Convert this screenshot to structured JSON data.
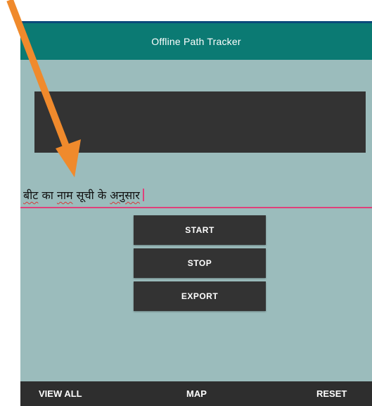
{
  "app_bar": {
    "title": "Offline Path Tracker"
  },
  "input": {
    "parts": [
      {
        "text": "बीट",
        "underline": true
      },
      {
        "text": " का ",
        "underline": false
      },
      {
        "text": "नाम",
        "underline": true
      },
      {
        "text": " सूची के ",
        "underline": false
      },
      {
        "text": "अनुसार",
        "underline": true
      }
    ]
  },
  "buttons": {
    "start": "START",
    "stop": "STOP",
    "export": "EXPORT"
  },
  "bottom_bar": {
    "view_all": "VIEW ALL",
    "map": "MAP",
    "reset": "RESET"
  },
  "colors": {
    "app_bar": "#0b7a73",
    "background": "#9bbcbc",
    "button": "#333333",
    "input_underline": "#e0407a",
    "annotation_arrow": "#f08a2c"
  },
  "annotation": {
    "icon": "arrow-pointer-icon"
  }
}
